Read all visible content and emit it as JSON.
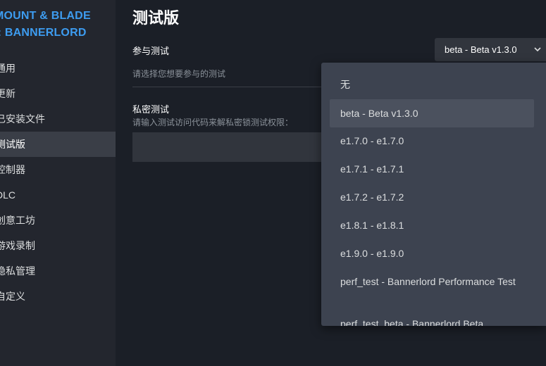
{
  "sidebar": {
    "game_title_line1": "MOUNT & BLADE",
    "game_title_line2": "I: BANNERLORD",
    "items": [
      {
        "label": "通用"
      },
      {
        "label": "更新"
      },
      {
        "label": "已安装文件"
      },
      {
        "label": "测试版"
      },
      {
        "label": "控制器"
      },
      {
        "label": "DLC"
      },
      {
        "label": "创意工坊"
      },
      {
        "label": "游戏录制"
      },
      {
        "label": "隐私管理"
      },
      {
        "label": "自定义"
      }
    ],
    "active_index": 3
  },
  "main": {
    "title": "测试版",
    "beta_label": "参与测试",
    "beta_hint": "请选择您想要参与的测试",
    "private_label": "私密测试",
    "private_hint": "请输入测试访问代码来解私密锁测试权限：",
    "code_value": ""
  },
  "select": {
    "value": "beta - Beta v1.3.0"
  },
  "dropdown": {
    "options": [
      {
        "label": "无"
      },
      {
        "label": "beta - Beta v1.3.0",
        "selected": true
      },
      {
        "label": "e1.7.0 - e1.7.0"
      },
      {
        "label": "e1.7.1 - e1.7.1"
      },
      {
        "label": "e1.7.2 - e1.7.2"
      },
      {
        "label": "e1.8.1 - e1.8.1"
      },
      {
        "label": "e1.9.0 - e1.9.0"
      },
      {
        "label": "perf_test - Bannerlord Performance Test"
      },
      {
        "label": "perf_test_beta - Bannerlord Beta"
      }
    ]
  },
  "colors": {
    "accent": "#3d9cf0",
    "background": "#1b1f27",
    "sidebar": "#23262e",
    "dropdown": "#3d4350"
  }
}
